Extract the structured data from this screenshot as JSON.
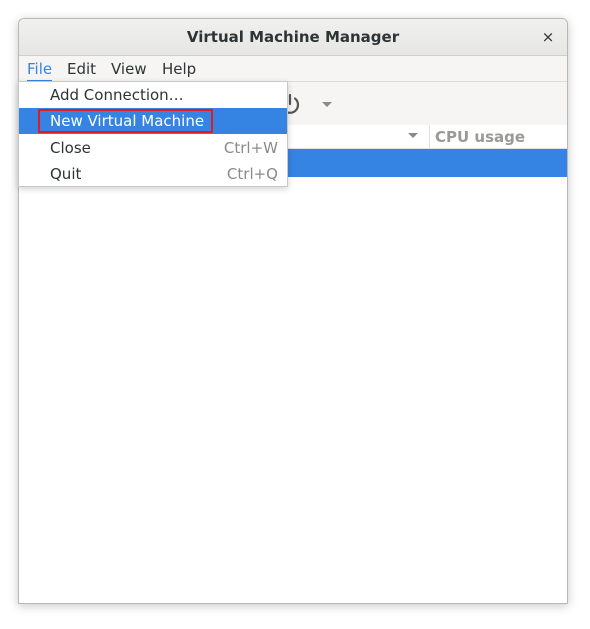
{
  "window": {
    "title": "Virtual Machine Manager",
    "close_glyph": "×"
  },
  "menubar": {
    "file": "File",
    "edit": "Edit",
    "view": "View",
    "help": "Help"
  },
  "file_menu": {
    "items": [
      {
        "label": "Add Connection…",
        "accel": ""
      },
      {
        "label": "New Virtual Machine",
        "accel": ""
      },
      {
        "label": "Close",
        "accel": "Ctrl+W"
      },
      {
        "label": "Quit",
        "accel": "Ctrl+Q"
      }
    ]
  },
  "table": {
    "cpu_header": "CPU usage"
  },
  "toolbar": {
    "icons": [
      "shutdown-icon",
      "chevron-down-icon"
    ]
  },
  "colors": {
    "accent": "#3584e4",
    "highlight_border": "#e01b24"
  }
}
